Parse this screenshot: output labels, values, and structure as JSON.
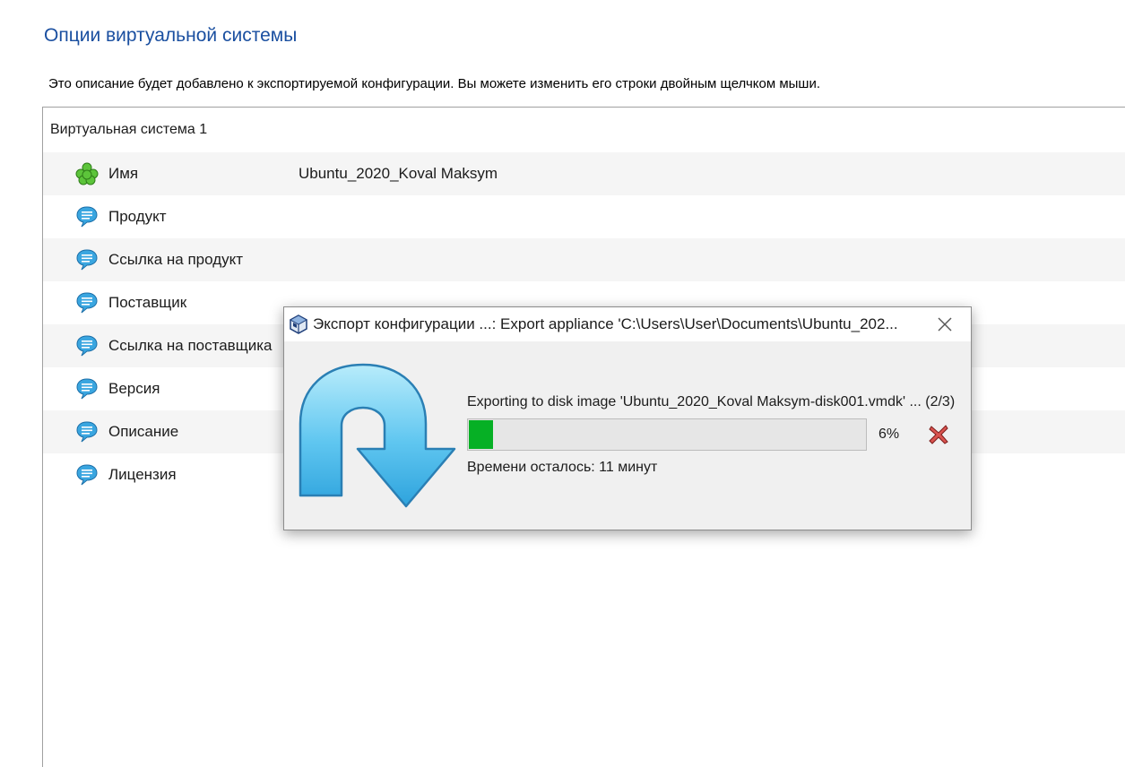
{
  "page": {
    "title": "Опции виртуальной системы",
    "description": "Это описание будет добавлено к экспортируемой конфигурации. Вы можете изменить его строки двойным щелчком мыши."
  },
  "tree": {
    "root_label": "Виртуальная система 1",
    "rows": [
      {
        "label": "Имя",
        "value": "Ubuntu_2020_Koval Maksym",
        "icon": "name-icon"
      },
      {
        "label": "Продукт",
        "value": "",
        "icon": "speech-bubble-icon"
      },
      {
        "label": "Ссылка на продукт",
        "value": "",
        "icon": "speech-bubble-icon"
      },
      {
        "label": "Поставщик",
        "value": "",
        "icon": "speech-bubble-icon"
      },
      {
        "label": "Ссылка на поставщика",
        "value": "",
        "icon": "speech-bubble-icon"
      },
      {
        "label": "Версия",
        "value": "",
        "icon": "speech-bubble-icon"
      },
      {
        "label": "Описание",
        "value": "",
        "icon": "speech-bubble-icon"
      },
      {
        "label": "Лицензия",
        "value": "",
        "icon": "speech-bubble-icon"
      }
    ]
  },
  "dialog": {
    "title": "Экспорт конфигурации ...: Export appliance 'C:\\Users\\User\\Documents\\Ubuntu_202...",
    "operation": "Exporting to disk image 'Ubuntu_2020_Koval Maksym-disk001.vmdk' ... (2/3)",
    "progress_percent": 6,
    "progress_label": "6%",
    "time_remaining": "Времени осталось: 11 минут",
    "app_icon": "virtualbox-icon",
    "close_icon": "close-icon",
    "cancel_icon": "cancel-icon",
    "arrow_icon": "export-arrow-icon"
  },
  "colors": {
    "title_blue": "#1a4fa0",
    "progress_green": "#06b025",
    "cancel_red": "#c0392b"
  }
}
